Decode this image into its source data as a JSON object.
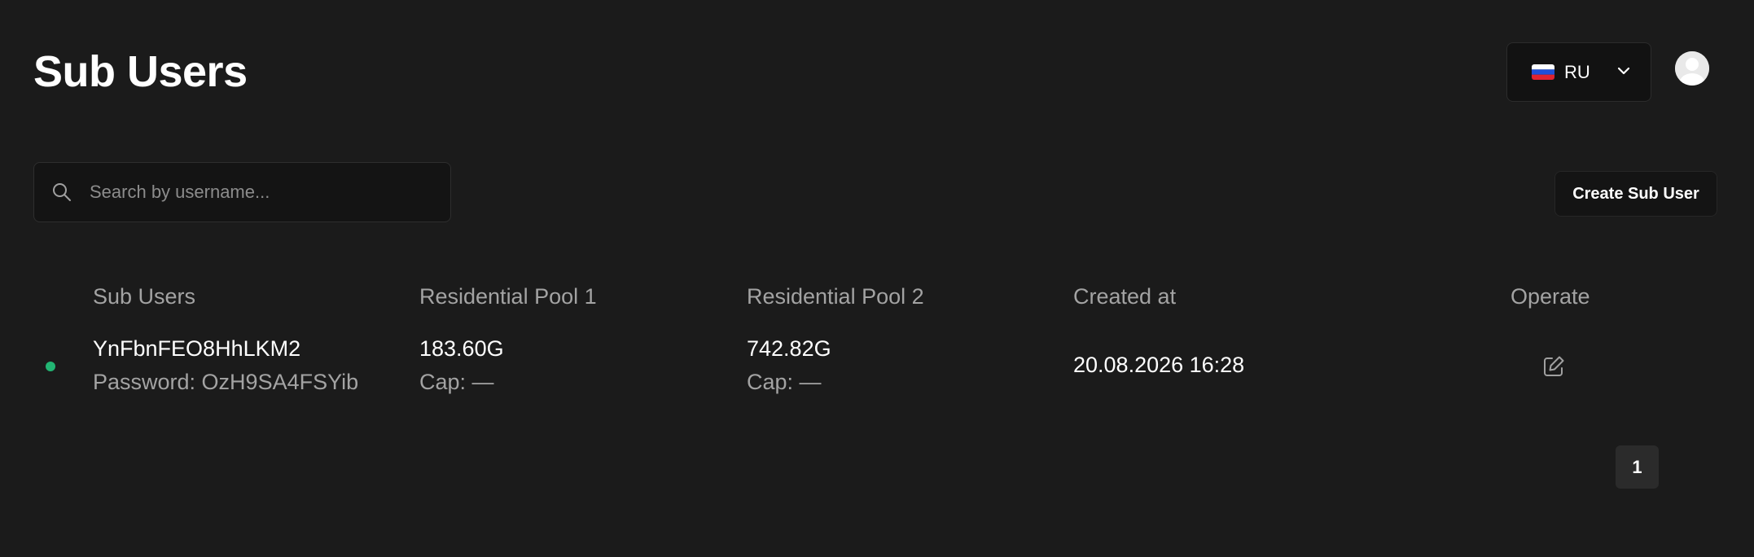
{
  "header": {
    "title": "Sub Users",
    "language": {
      "flag_icon": "russia-flag-icon",
      "code": "RU"
    },
    "avatar_icon": "user-avatar-icon"
  },
  "toolbar": {
    "search": {
      "placeholder": "Search by username...",
      "value": "",
      "icon": "search-icon"
    },
    "create_button_label": "Create Sub User"
  },
  "table": {
    "columns": [
      "Sub Users",
      "Residential Pool 1",
      "Residential Pool 2",
      "Created at",
      "Operate"
    ],
    "rows": [
      {
        "status": "active",
        "status_color": "#22b573",
        "username": "YnFbnFEO8HhLKM2",
        "password_line": "Password: OzH9SA4FSYib",
        "pool1_usage": "183.60G",
        "pool1_cap": "Cap: —",
        "pool2_usage": "742.82G",
        "pool2_cap": "Cap: —",
        "created_at": "20.08.2026 16:28",
        "operate_icon": "edit-icon"
      }
    ]
  },
  "pagination": {
    "current_page": "1"
  },
  "colors": {
    "background": "#1b1b1b",
    "muted_text": "#a3a3a3",
    "status_active": "#22b573"
  }
}
